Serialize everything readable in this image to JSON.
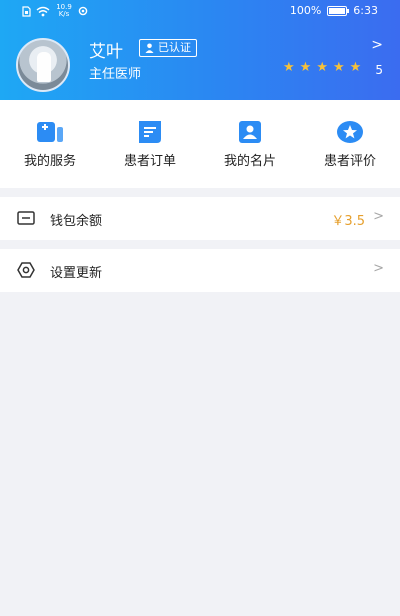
{
  "status_bar": {
    "net_speed_top": "10.9",
    "net_speed_unit": "K/s",
    "battery": "100%",
    "time": "6:33"
  },
  "profile": {
    "name": "艾叶",
    "badge": "已认证",
    "title": "主任医师",
    "stars": 5,
    "rating": "5"
  },
  "menu": {
    "items": [
      {
        "label": "我的服务",
        "icon": "service-icon"
      },
      {
        "label": "患者订单",
        "icon": "order-icon"
      },
      {
        "label": "我的名片",
        "icon": "card-icon"
      },
      {
        "label": "患者评价",
        "icon": "review-icon"
      }
    ]
  },
  "wallet": {
    "label": "钱包余额",
    "value": "￥3.5"
  },
  "settings": {
    "label": "设置更新"
  },
  "colors": {
    "accent": "#2b86f2",
    "star": "#f6c13a",
    "amount": "#e6a02e"
  }
}
